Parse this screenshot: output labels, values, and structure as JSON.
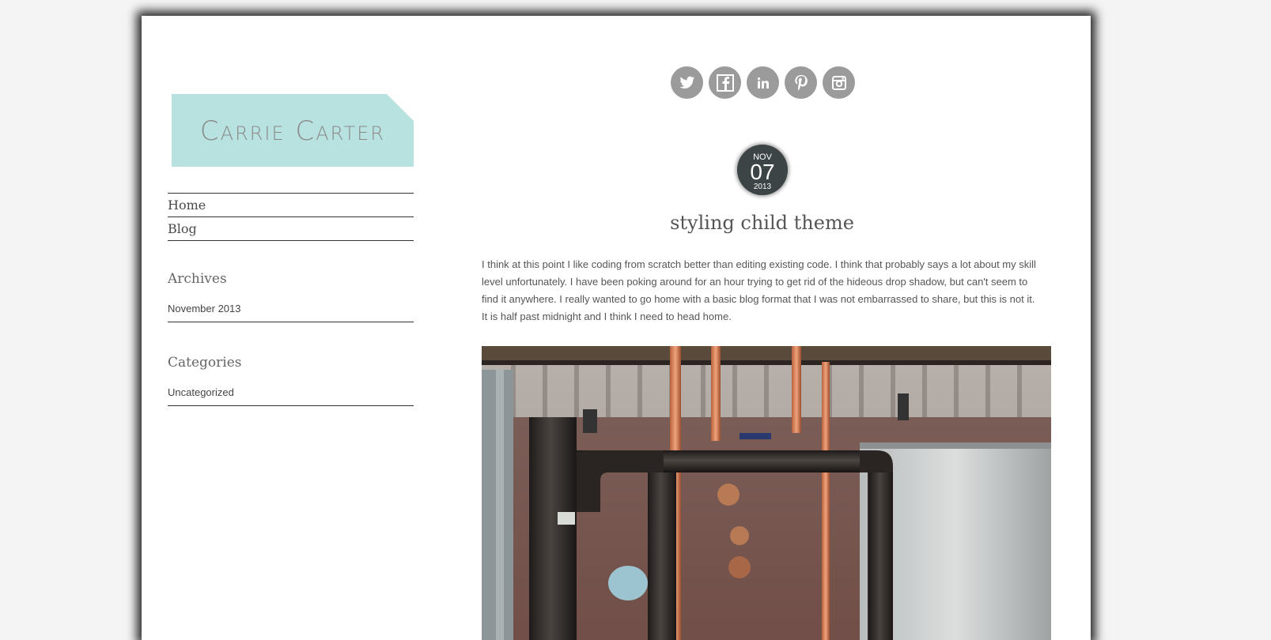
{
  "site": {
    "logo_text": "Carrie Carter"
  },
  "nav": {
    "items": [
      {
        "label": "Home"
      },
      {
        "label": "Blog"
      }
    ]
  },
  "widgets": {
    "archives": {
      "title": "Archives",
      "links": [
        "November 2013"
      ]
    },
    "categories": {
      "title": "Categories",
      "links": [
        "Uncategorized"
      ]
    }
  },
  "social": {
    "icons": [
      "twitter-icon",
      "facebook-icon",
      "linkedin-icon",
      "pinterest-icon",
      "instagram-icon"
    ]
  },
  "post": {
    "date": {
      "month": "NOV",
      "day": "07",
      "year": "2013"
    },
    "title": "styling child theme",
    "body": "I think at this point I like coding from scratch better than editing existing code. I think that probably says a lot about my skill level unfortunately. I have been poking around for an hour trying to get rid of the hideous drop shadow, but can't seem to find it anywhere. I really wanted to go home with a basic blog format that I was not embarrassed to share, but this is not it. It is half past midnight and I think I need to head home.",
    "image": {
      "alt": "industrial pipes photo"
    }
  },
  "colors": {
    "logo_bg": "#b8e2df",
    "social_bg": "#9b9b9b",
    "badge_bg": "#3d4446",
    "page_bg": "#f4f4f4"
  }
}
